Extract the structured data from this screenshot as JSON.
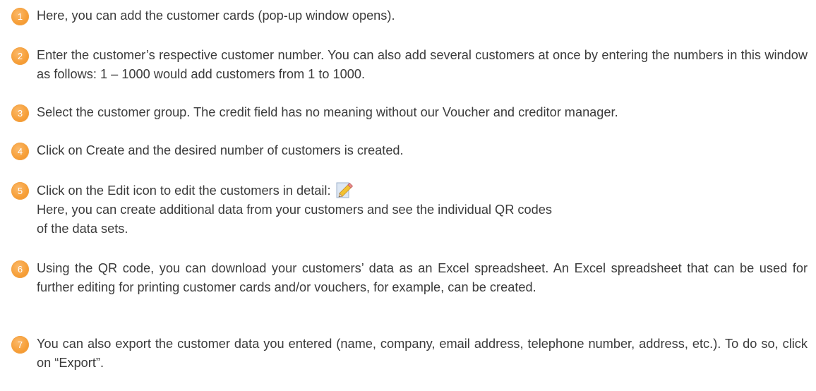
{
  "steps": [
    {
      "number": "1",
      "text": "Here, you can add the customer cards (pop-up window opens)."
    },
    {
      "number": "2",
      "text": "Enter the customer’s respective customer number. You can also add several customers at once by entering the numbers in this window as follows: 1 – 1000 would add customers from 1 to 1000."
    },
    {
      "number": "3",
      "text": "Select the customer group. The credit field has no meaning without our Voucher and creditor manager."
    },
    {
      "number": "4",
      "text": "Click on Create and the desired number of customers is created."
    },
    {
      "number": "5",
      "line1": "Click on the Edit icon to edit the customers in detail:",
      "line2": "Here, you can create additional data from your customers and see the individual QR codes",
      "line3": "of the data sets.",
      "icon": "edit-pencil-icon"
    },
    {
      "number": "6",
      "text": "Using the QR code, you can download your customers’ data as an Excel spreadsheet. An Excel spreadsheet that can be used for further editing for printing customer cards and/or vouchers, for example, can be created."
    },
    {
      "number": "7",
      "text": "You can also export the customer data you entered (name, company, email address, telephone number, address, etc.). To do so, click on “Export”."
    }
  ],
  "colors": {
    "badge": "#f7a03a",
    "text": "#3b3b3b"
  }
}
